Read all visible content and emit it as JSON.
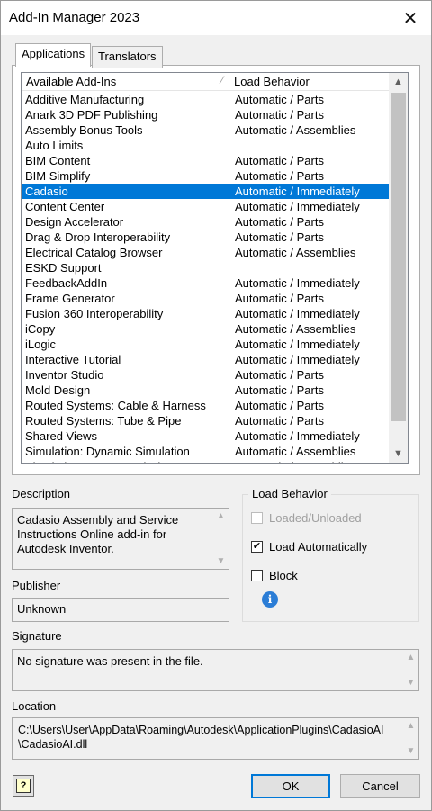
{
  "window": {
    "title": "Add-In Manager 2023",
    "close_glyph": "✕"
  },
  "tabs": [
    {
      "label": "Applications",
      "active": true
    },
    {
      "label": "Translators",
      "active": false
    }
  ],
  "addin_list": {
    "columns": [
      "Available Add-Ins",
      "Load Behavior"
    ],
    "sort_glyph": "⁄",
    "selected_index": 6,
    "rows": [
      [
        "Additive Manufacturing",
        "Automatic / Parts"
      ],
      [
        "Anark 3D PDF Publishing",
        "Automatic / Parts"
      ],
      [
        "Assembly Bonus Tools",
        "Automatic / Assemblies"
      ],
      [
        "Auto Limits",
        ""
      ],
      [
        "BIM Content",
        "Automatic / Parts"
      ],
      [
        "BIM Simplify",
        "Automatic / Parts"
      ],
      [
        "Cadasio",
        "Automatic / Immediately"
      ],
      [
        "Content Center",
        "Automatic / Immediately"
      ],
      [
        "Design Accelerator",
        "Automatic / Parts"
      ],
      [
        "Drag & Drop Interoperability",
        "Automatic / Parts"
      ],
      [
        "Electrical Catalog Browser",
        "Automatic / Assemblies"
      ],
      [
        "ESKD Support",
        ""
      ],
      [
        "FeedbackAddIn",
        "Automatic / Immediately"
      ],
      [
        "Frame Generator",
        "Automatic / Parts"
      ],
      [
        "Fusion 360 Interoperability",
        "Automatic / Immediately"
      ],
      [
        "iCopy",
        "Automatic / Assemblies"
      ],
      [
        "iLogic",
        "Automatic / Immediately"
      ],
      [
        "Interactive Tutorial",
        "Automatic / Immediately"
      ],
      [
        "Inventor Studio",
        "Automatic / Parts"
      ],
      [
        "Mold Design",
        "Automatic / Parts"
      ],
      [
        "Routed Systems: Cable & Harness",
        "Automatic / Parts"
      ],
      [
        "Routed Systems: Tube & Pipe",
        "Automatic / Parts"
      ],
      [
        "Shared Views",
        "Automatic / Immediately"
      ],
      [
        "Simulation: Dynamic Simulation",
        "Automatic / Assemblies"
      ],
      [
        "Simulation: Frame Analysis",
        "Automatic / Assemblies"
      ]
    ]
  },
  "description": {
    "label": "Description",
    "text": "Cadasio Assembly and Service\nInstructions Online add-in for\nAutodesk Inventor."
  },
  "publisher": {
    "label": "Publisher",
    "value": "Unknown"
  },
  "signature": {
    "label": "Signature",
    "value": "No signature was present in the file."
  },
  "location": {
    "label": "Location",
    "value": "C:\\Users\\User\\AppData\\Roaming\\Autodesk\\ApplicationPlugins\\CadasioAI\n\\CadasioAI.dll"
  },
  "load_behavior": {
    "title": "Load Behavior",
    "options": [
      {
        "label": "Loaded/Unloaded",
        "checked": false,
        "enabled": false
      },
      {
        "label": "Load Automatically",
        "checked": true,
        "enabled": true
      },
      {
        "label": "Block",
        "checked": false,
        "enabled": true
      }
    ],
    "info_glyph": "i"
  },
  "buttons": {
    "ok": "OK",
    "cancel": "Cancel",
    "help_glyph": "?"
  },
  "colors": {
    "selection": "#0078d7",
    "info": "#2b7dd6",
    "default_button_border": "#0078d7"
  }
}
